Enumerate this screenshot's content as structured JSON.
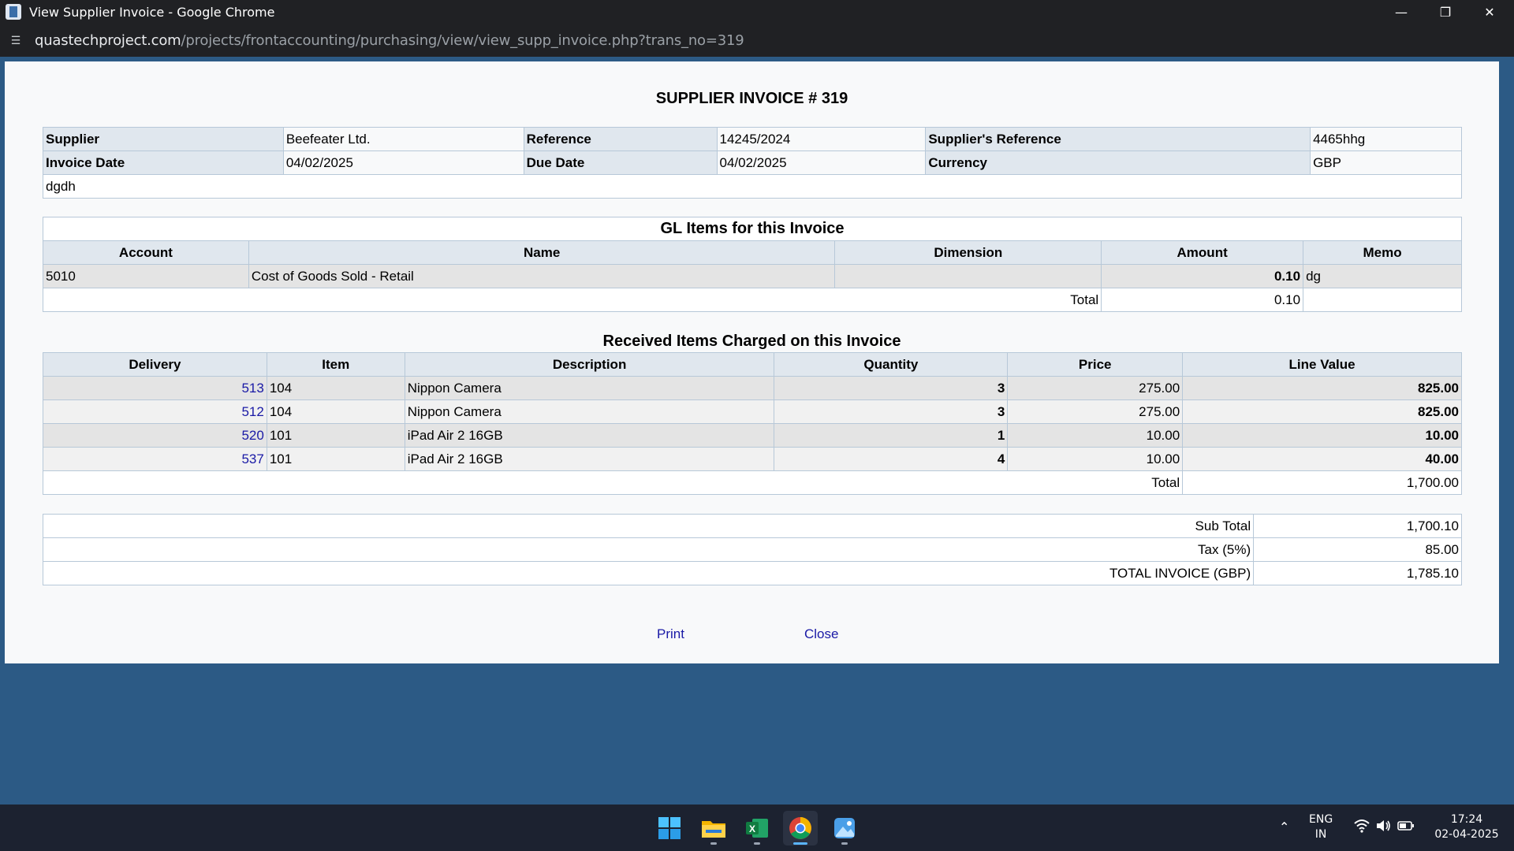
{
  "window": {
    "title": "View Supplier Invoice - Google Chrome",
    "url_host": "quastechproject.com",
    "url_path": "/projects/frontaccounting/purchasing/view/view_supp_invoice.php?trans_no=319"
  },
  "invoice": {
    "title": "SUPPLIER INVOICE # 319",
    "labels": {
      "supplier": "Supplier",
      "reference": "Reference",
      "supplier_reference": "Supplier's Reference",
      "invoice_date": "Invoice Date",
      "due_date": "Due Date",
      "currency": "Currency"
    },
    "supplier": "Beefeater Ltd.",
    "reference": "14245/2024",
    "supplier_reference": "4465hhg",
    "invoice_date": "04/02/2025",
    "due_date": "04/02/2025",
    "currency": "GBP",
    "memo": "dgdh"
  },
  "gl": {
    "title": "GL Items for this Invoice",
    "headers": [
      "Account",
      "Name",
      "Dimension",
      "Amount",
      "Memo"
    ],
    "rows": [
      {
        "account": "5010",
        "name": "Cost of Goods Sold - Retail",
        "dimension": "",
        "amount": "0.10",
        "memo": "dg"
      }
    ],
    "total_label": "Total",
    "total": "0.10"
  },
  "received": {
    "title": "Received Items Charged on this Invoice",
    "headers": [
      "Delivery",
      "Item",
      "Description",
      "Quantity",
      "Price",
      "Line Value"
    ],
    "rows": [
      {
        "delivery": "513",
        "item": "104",
        "description": "Nippon Camera",
        "quantity": "3",
        "price": "275.00",
        "line_value": "825.00"
      },
      {
        "delivery": "512",
        "item": "104",
        "description": "Nippon Camera",
        "quantity": "3",
        "price": "275.00",
        "line_value": "825.00"
      },
      {
        "delivery": "520",
        "item": "101",
        "description": "iPad Air 2 16GB",
        "quantity": "1",
        "price": "10.00",
        "line_value": "10.00"
      },
      {
        "delivery": "537",
        "item": "101",
        "description": "iPad Air 2 16GB",
        "quantity": "4",
        "price": "10.00",
        "line_value": "40.00"
      }
    ],
    "total_label": "Total",
    "total": "1,700.00"
  },
  "summary": {
    "sub_total_label": "Sub Total",
    "sub_total": "1,700.10",
    "tax_label": "Tax (5%)",
    "tax": "85.00",
    "grand_label": "TOTAL INVOICE (GBP)",
    "grand_total": "1,785.10"
  },
  "actions": {
    "print": "Print",
    "close": "Close"
  },
  "taskbar": {
    "apps": [
      "windows-start-icon",
      "file-explorer-icon",
      "excel-icon",
      "chrome-icon",
      "photos-icon"
    ],
    "lang": "ENG",
    "region": "IN",
    "time": "17:24",
    "date": "02-04-2025"
  }
}
